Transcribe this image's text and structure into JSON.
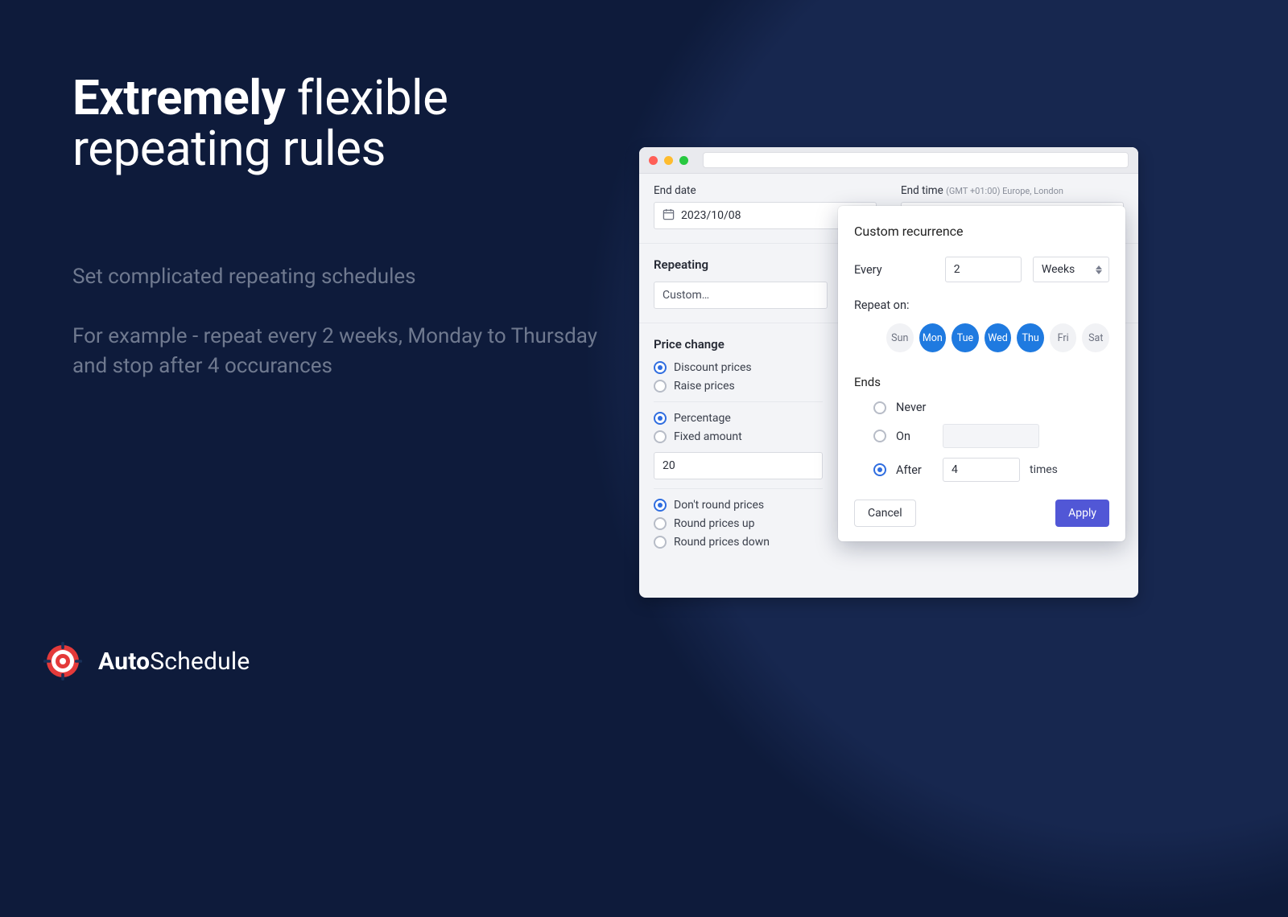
{
  "hero": {
    "title_strong": "Extremely",
    "title_rest": " flexible repeating rules",
    "lead": "Set complicated repeating schedules",
    "body": "For example - repeat every 2 weeks, Monday to Thursday and stop after 4 occurances"
  },
  "brand": {
    "name_strong": "Auto",
    "name_rest": "Schedule"
  },
  "window": {
    "end_date_label": "End date",
    "end_date_value": "2023/10/08",
    "end_time_label": "End time",
    "end_time_tz": "(GMT +01:00) Europe, London",
    "repeating_title": "Repeating",
    "repeating_value": "Custom…",
    "price_change_title": "Price change",
    "price_dir": {
      "discount": "Discount prices",
      "raise": "Raise prices"
    },
    "price_mode": {
      "percentage": "Percentage",
      "fixed": "Fixed amount"
    },
    "price_value": "20",
    "rounding": {
      "none": "Don't round prices",
      "up": "Round prices up",
      "down": "Round prices down"
    }
  },
  "popover": {
    "title": "Custom recurrence",
    "every_label": "Every",
    "every_value": "2",
    "unit_value": "Weeks",
    "repeat_on_label": "Repeat on:",
    "days": [
      {
        "short": "Sun",
        "on": false
      },
      {
        "short": "Mon",
        "on": true
      },
      {
        "short": "Tue",
        "on": true
      },
      {
        "short": "Wed",
        "on": true
      },
      {
        "short": "Thu",
        "on": true
      },
      {
        "short": "Fri",
        "on": false
      },
      {
        "short": "Sat",
        "on": false
      }
    ],
    "ends_title": "Ends",
    "ends": {
      "never": "Never",
      "on": "On",
      "after": "After",
      "after_value": "4",
      "after_suffix": "times"
    },
    "cancel": "Cancel",
    "apply": "Apply"
  }
}
